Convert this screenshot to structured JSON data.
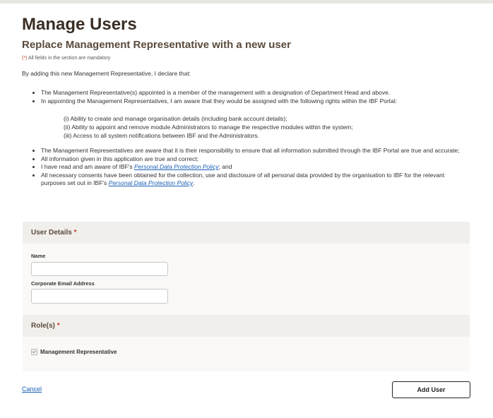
{
  "page": {
    "title": "Manage Users",
    "subtitle": "Replace Management Representative with a new user",
    "mandatory_asterisk": "(*)",
    "mandatory_text": " All fields in the section are mandatory",
    "declaration_intro": "By adding this new Management Representative, I declare that:"
  },
  "bullets_top": [
    "The Management Representative(s) appointed is a member of the management with a designation of Department Head and above.",
    "In appointing the Management Representatives, I am aware that they would be assigned with the following rights within the IBF Portal:"
  ],
  "rights": [
    "(i) Ability to create and manage organisation details (including bank account details);",
    "(ii) Ability to appoint and remove module Administrators to manage the respective modules within the system;",
    "(iii) Access to all system notifications between IBF and the Administrators."
  ],
  "bullets_bottom": {
    "b1": "The Management Representatives are aware that it is their responsibility to ensure that all information submitted through the IBF Portal are true and accurate;",
    "b2": "All information given in this application are true and correct;",
    "b3_prefix": "I have read and am aware of IBF's ",
    "b3_link": "Personal Data Protection Policy",
    "b3_suffix": "; and",
    "b4_prefix": "All necessary consents have been obtained for the collection, use and disclosure of all personal data provided by the organisation to IBF for the relevant purposes set out in IBF's ",
    "b4_link": "Personal Data Protection Policy",
    "b4_suffix": "."
  },
  "user_details": {
    "heading": "User Details",
    "required_mark": "*",
    "name_label": "Name",
    "name_value": "",
    "email_label": "Corporate Email Address",
    "email_value": ""
  },
  "roles": {
    "heading": "Role(s)",
    "required_mark": "*",
    "option_label": "Management Representative",
    "option_checked": true
  },
  "actions": {
    "cancel_label": "Cancel",
    "add_label": "Add User"
  },
  "colors": {
    "heading": "#3a2e25",
    "panel_header": "#f1efeb",
    "panel_body": "#faf9f7",
    "link": "#1a5fb4",
    "required": "#c0392b"
  }
}
